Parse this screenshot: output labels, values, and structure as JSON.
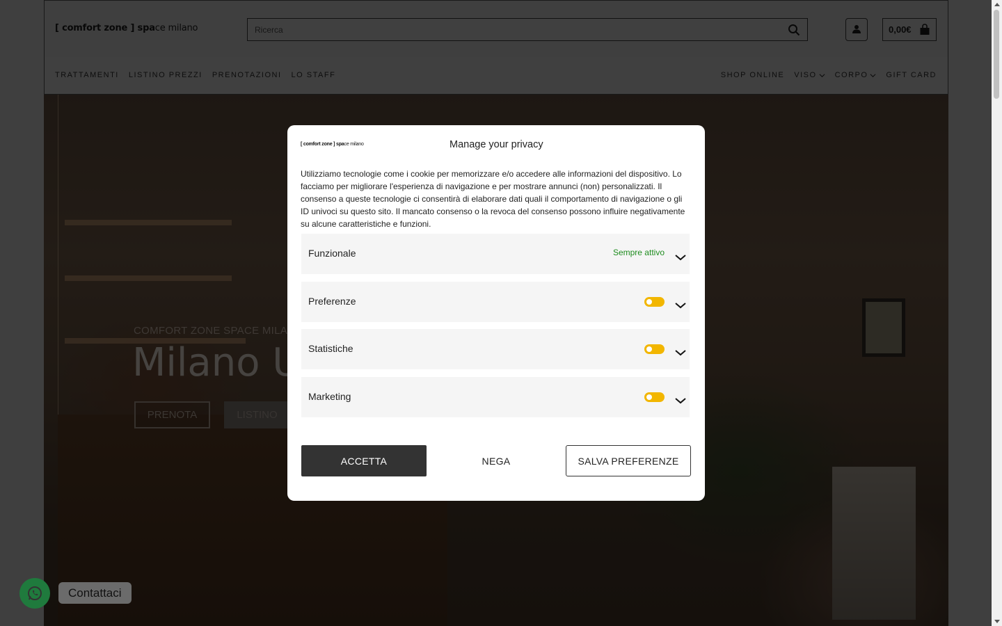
{
  "header": {
    "logo_bold": "[ comfort zone ] spa",
    "logo_rest": "ce milano",
    "search_placeholder": "Ricerca",
    "cart_total": "0,00€",
    "icons": {
      "search": "search-icon",
      "account": "user-icon",
      "cart": "shopping-bag-icon"
    }
  },
  "nav": {
    "left": [
      "TRATTAMENTI",
      "LISTINO PREZZI",
      "PRENOTAZIONI",
      "LO STAFF"
    ],
    "right": [
      {
        "label": "SHOP ONLINE",
        "dropdown": false
      },
      {
        "label": "VISO",
        "dropdown": true
      },
      {
        "label": "CORPO",
        "dropdown": true
      },
      {
        "label": "GIFT CARD",
        "dropdown": false
      }
    ]
  },
  "hero": {
    "subtitle": "COMFORT ZONE SPACE MILANO",
    "title": "Milano U",
    "btn_book": "PRENOTA",
    "btn_list": "LISTINO"
  },
  "whatsapp": {
    "label": "Contattaci",
    "icon": "whatsapp-icon"
  },
  "cookie_modal": {
    "logo_bold": "[ comfort zone ] spa",
    "logo_rest": "ce milano",
    "title": "Manage your privacy",
    "text": "Utilizziamo tecnologie come i cookie per memorizzare e/o accedere alle informazioni del dispositivo. Lo facciamo per migliorare l'esperienza di navigazione e per mostrare annunci (non) personalizzati. Il consenso a queste tecnologie ci consentirà di elaborare dati quali il comportamento di navigazione o gli ID univoci su questo sito. Il mancato consenso o la revoca del consenso possono influire negativamente su alcune caratteristiche e funzioni.",
    "categories": [
      {
        "name": "Funzionale",
        "status": "Sempre attivo",
        "toggle": false
      },
      {
        "name": "Preferenze",
        "status": "",
        "toggle": true
      },
      {
        "name": "Statistiche",
        "status": "",
        "toggle": true
      },
      {
        "name": "Marketing",
        "status": "",
        "toggle": true
      }
    ],
    "btn_accept": "ACCETTA",
    "btn_deny": "NEGA",
    "btn_save": "SALVA PREFERENZE",
    "toggle_color": "#f2b600"
  }
}
